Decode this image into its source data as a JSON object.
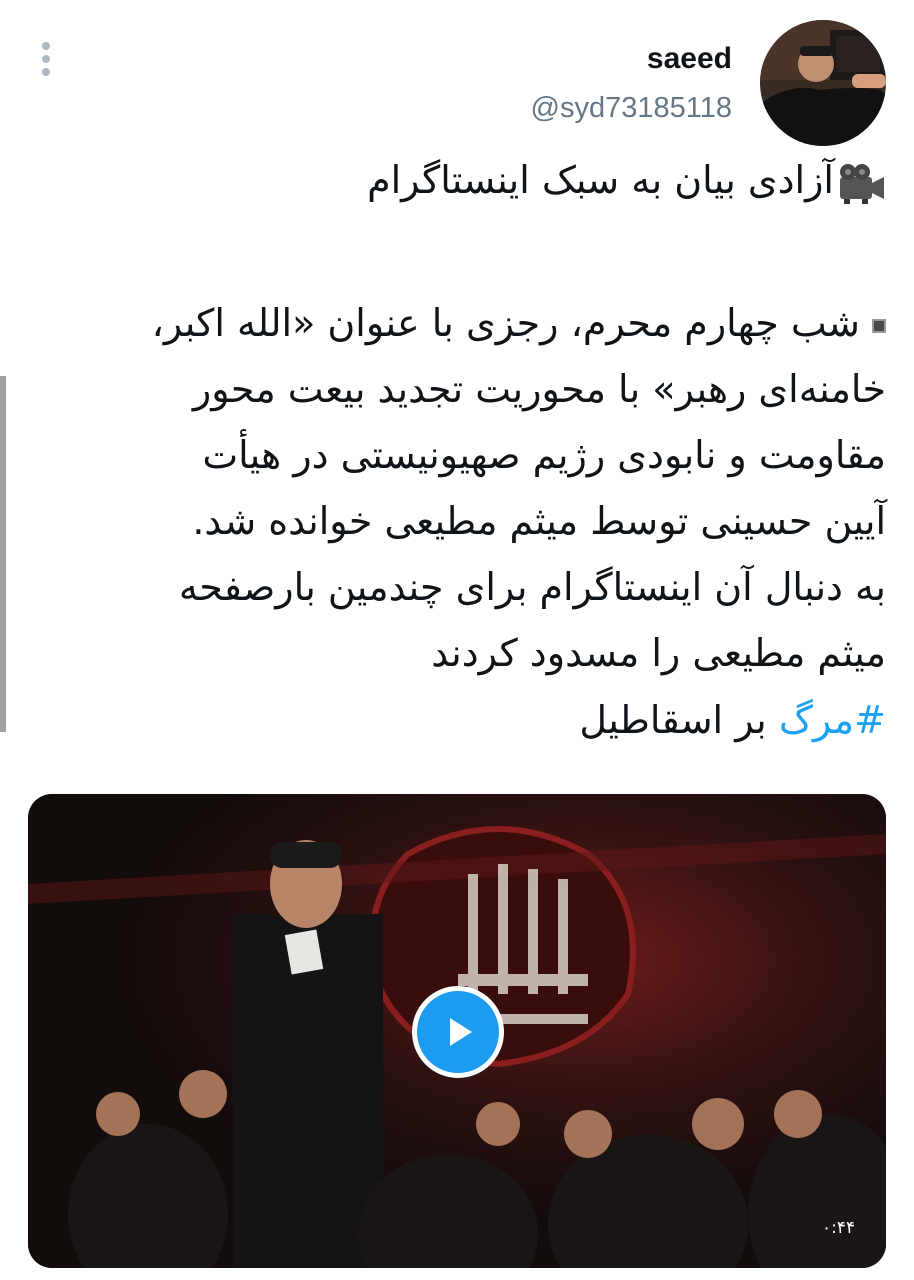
{
  "user": {
    "display_name": "saeed",
    "handle": "@syd73185118"
  },
  "tweet": {
    "title_icon": "video-camera-icon",
    "title": "آزادی بیان به سبک اینستاگرام",
    "bullet_icon": "small-square-icon",
    "body_lines": [
      "شب چهارم محرم، رجزی با عنوان «الله اکبر،",
      "خامنه‌ای رهبر» با محوریت تجدید بیعت محور",
      "مقاومت و نابودی رژیم صهیونیستی در هیأت",
      "آیین حسینی توسط میثم مطیعی خوانده شد.",
      "به دنبال آن اینستاگرام برای چندمین بارصفحه",
      "میثم مطیعی را مسدود کردند"
    ],
    "hashtag_text": "#مرگ",
    "hashtag_suffix": "بر اسقاطیل"
  },
  "media": {
    "type": "video",
    "play_icon": "play-icon",
    "duration": "۰:۴۴"
  },
  "colors": {
    "link": "#1da1f2",
    "handle": "#657786",
    "text": "#0f1419"
  }
}
